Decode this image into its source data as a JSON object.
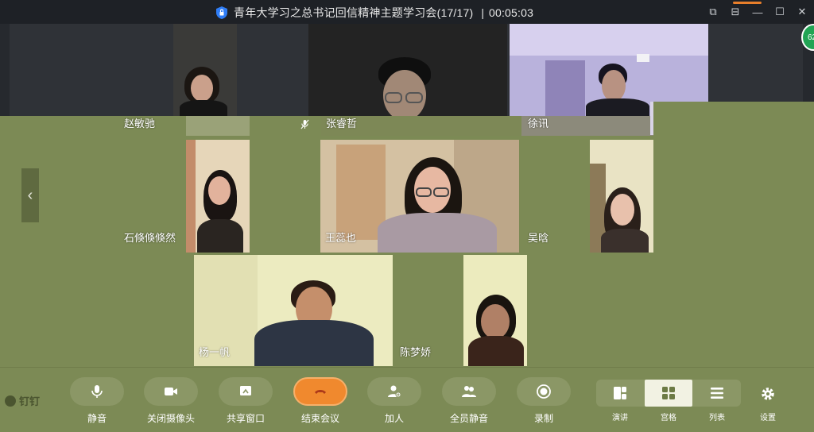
{
  "window": {
    "title": "青年大学习之总书记回信精神主题学习会(17/17)",
    "timer": "00:05:03"
  },
  "bubble": {
    "text": "62"
  },
  "participants": {
    "p1": "赵敏驰",
    "p2": "张睿哲",
    "p3": "徐讯",
    "p4": "石倏倏倏然",
    "p5": "王蕊也",
    "p6": "吴晗",
    "p7": "杨一帆",
    "p8": "陈梦娇"
  },
  "brand": {
    "name": "钉钉"
  },
  "toolbar": {
    "mute": "静音",
    "camera_off": "关闭摄像头",
    "share_window": "共享窗口",
    "end_meeting": "结束会议",
    "add_person": "加人",
    "mute_all": "全员静音",
    "record": "录制"
  },
  "layout": {
    "speaker": "演讲",
    "grid": "宫格",
    "list": "列表",
    "settings": "设置"
  },
  "colors": {
    "stage": "#7c8a55",
    "titlebar": "#1e2126",
    "end_button": "#f0892e"
  }
}
